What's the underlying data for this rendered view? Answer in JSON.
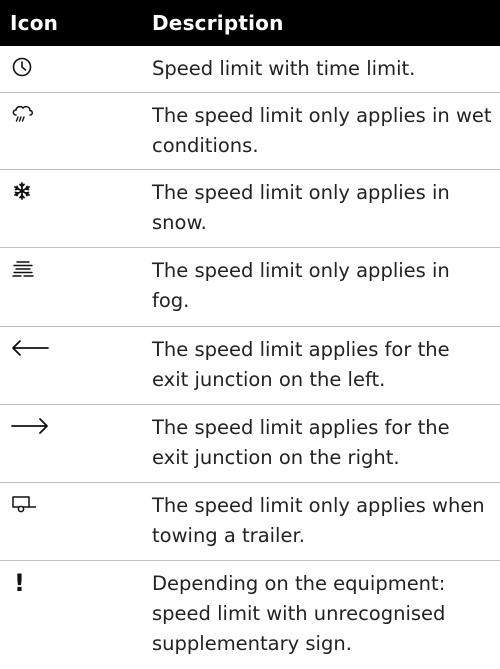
{
  "table": {
    "headers": {
      "icon": "Icon",
      "description": "Description"
    },
    "rows": [
      {
        "icon": "clock-icon",
        "description": "Speed limit with time limit."
      },
      {
        "icon": "rain-cloud-icon",
        "description": "The speed limit only applies in wet conditions."
      },
      {
        "icon": "snowflake-icon",
        "description": "The speed limit only applies in snow."
      },
      {
        "icon": "fog-icon",
        "description": "The speed limit only applies in fog."
      },
      {
        "icon": "arrow-left-icon",
        "description": "The speed limit applies for the exit junction on the left."
      },
      {
        "icon": "arrow-right-icon",
        "description": "The speed limit applies for the exit junction on the right."
      },
      {
        "icon": "trailer-icon",
        "description": "The speed limit only applies when towing a trailer."
      },
      {
        "icon": "exclamation-icon",
        "icon_text": "!",
        "description": "Depending on the equipment: speed limit with unrecognised supplementary sign."
      }
    ]
  },
  "colors": {
    "header_background": "#000000",
    "header_text": "#ffffff",
    "divider": "#bdbdbd",
    "body_text": "#222222"
  }
}
